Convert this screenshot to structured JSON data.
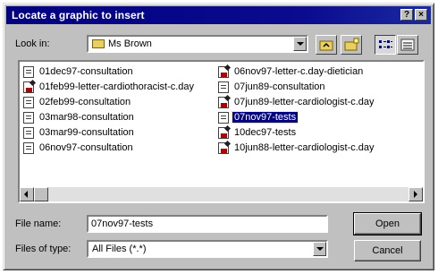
{
  "window": {
    "title": "Locate a graphic to insert",
    "help_glyph": "?",
    "close_glyph": "×"
  },
  "lookin": {
    "label": "Look in:",
    "folder_name": "Ms Brown"
  },
  "files_left": [
    {
      "name": "01dec97-consultation",
      "icon": "note-icon"
    },
    {
      "name": "01feb99-letter-cardiothoracist-c.day",
      "icon": "word-icon"
    },
    {
      "name": "02feb99-consultation",
      "icon": "note-icon"
    },
    {
      "name": "03mar98-consultation",
      "icon": "note-icon"
    },
    {
      "name": "03mar99-consultation",
      "icon": "note-icon"
    },
    {
      "name": "06nov97-consultation",
      "icon": "note-icon"
    }
  ],
  "files_right": [
    {
      "name": "06nov97-letter-c.day-dietician",
      "icon": "word-icon"
    },
    {
      "name": "07jun89-consultation",
      "icon": "note-icon"
    },
    {
      "name": "07jun89-letter-cardiologist-c.day",
      "icon": "word-icon"
    },
    {
      "name": "07nov97-tests",
      "icon": "note-icon",
      "selected": true
    },
    {
      "name": "10dec97-tests",
      "icon": "word-icon"
    },
    {
      "name": "10jun88-letter-cardiologist-c.day",
      "icon": "word-icon"
    }
  ],
  "filename": {
    "label": "File name:",
    "value": "07nov97-tests"
  },
  "filetype": {
    "label": "Files of type:",
    "value": "All Files (*.*)"
  },
  "buttons": {
    "open": "Open",
    "cancel": "Cancel"
  }
}
